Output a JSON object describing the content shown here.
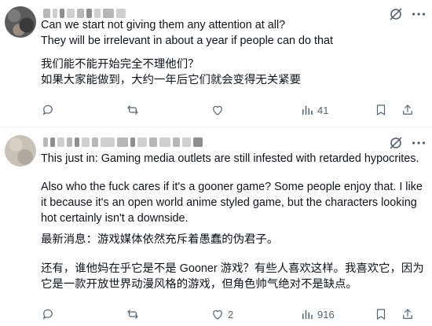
{
  "posts": [
    {
      "text_en": "Can we start not giving them any attention at all?\nThey will be irrelevant in about a year if people can do that",
      "text_zh": "我们能不能开始完全不理他们？\n如果大家能做到，大约一年后它们就会变得无关紧要",
      "actions": {
        "replies": "",
        "reposts": "",
        "likes": "",
        "views": "41"
      }
    },
    {
      "text_en_1": "This just in: Gaming media outlets are still infested with retarded hypocrites.",
      "text_en_2": "Also who the fuck cares if it's a gooner game? Some people enjoy that. I like it because it's an open world anime styled game, but the characters looking hot certainly isn't a downside.",
      "text_zh_1": "最新消息：游戏媒体依然充斥着愚蠢的伪君子。",
      "text_zh_2": "还有，谁他妈在乎它是不是 Gooner 游戏？有些人喜欢这样。我喜欢它，因为它是一款开放世界动漫风格的游戏，但角色帅气绝对不是缺点。",
      "actions": {
        "replies": "",
        "reposts": "",
        "likes": "2",
        "views": "916"
      }
    }
  ],
  "icons": {
    "grok": "grok-icon",
    "more": "more-icon",
    "reply": "reply-icon",
    "repost": "repost-icon",
    "like": "like-icon",
    "views": "views-icon",
    "bookmark": "bookmark-icon",
    "share": "share-icon"
  },
  "colors": {
    "icon_gray": "#536471",
    "text": "#0f1419",
    "divider": "#eff3f4"
  }
}
